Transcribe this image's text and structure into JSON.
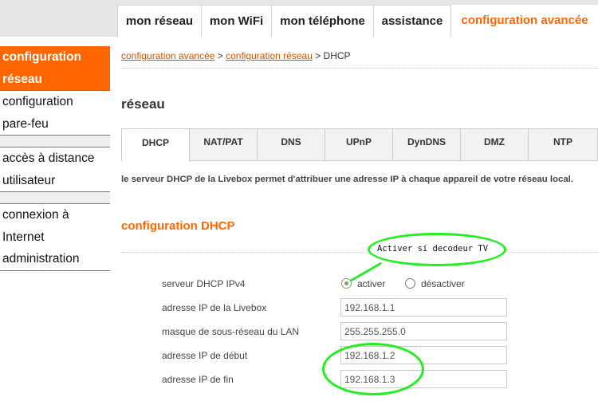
{
  "topnav": {
    "tabs": [
      {
        "label": "mon réseau",
        "active": false
      },
      {
        "label": "mon WiFi",
        "active": false
      },
      {
        "label": "mon téléphone",
        "active": false
      },
      {
        "label": "assistance",
        "active": false
      },
      {
        "label": "configuration avancée",
        "active": true
      }
    ]
  },
  "sidebar": {
    "group1": [
      "configuration",
      "réseau",
      "configuration",
      "pare-feu"
    ],
    "group2": [
      "accès à distance",
      "utilisateur"
    ],
    "group3": [
      "connexion à",
      "Internet",
      "administration"
    ]
  },
  "breadcrumb": {
    "link1": "configuration avancée",
    "sep": " > ",
    "link2": "configuration réseau",
    "current": " > DHCP"
  },
  "page_title": "réseau",
  "subtabs": [
    "DHCP",
    "NAT/PAT",
    "DNS",
    "UPnP",
    "DynDNS",
    "DMZ",
    "NTP"
  ],
  "active_subtab": "DHCP",
  "description": "le serveur DHCP de la Livebox permet d'attribuer une adresse IP à chaque appareil de votre réseau local.",
  "section_title": "configuration DHCP",
  "annotation": "Activer si decodeur TV",
  "form": {
    "dhcp_label": "serveur DHCP IPv4",
    "radio_on_label": "activer",
    "radio_off_label": "désactiver",
    "radio_selected": "activer",
    "fields": [
      {
        "label": "adresse IP de la Livebox",
        "value": "192.168.1.1"
      },
      {
        "label": "masque de sous-réseau du LAN",
        "value": "255.255.255.0"
      },
      {
        "label": "adresse IP de début",
        "value": "192.168.1.2"
      },
      {
        "label": "adresse IP de fin",
        "value": "192.168.1.3"
      }
    ]
  },
  "colors": {
    "accent": "#ff6600",
    "highlight": "#22ee22"
  }
}
